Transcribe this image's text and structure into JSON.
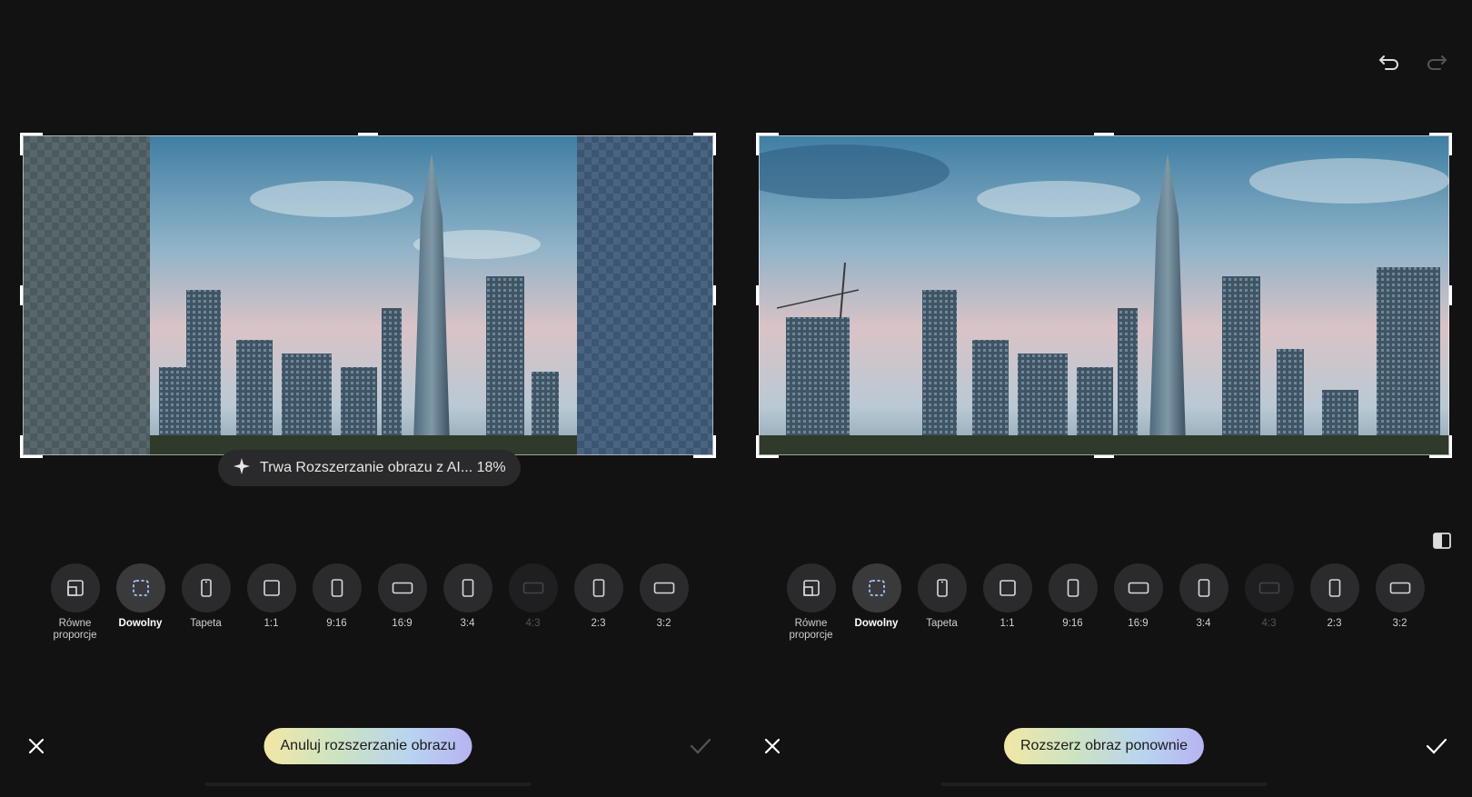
{
  "toolbar": {
    "undo_icon": "undo-icon",
    "redo_icon": "redo-icon"
  },
  "progress": {
    "text": "Trwa Rozszerzanie obrazu z AI... 18%",
    "percent": 18
  },
  "ratios": [
    {
      "label": "Równe proporcje",
      "icon": "free-aspect-icon"
    },
    {
      "label": "Dowolny",
      "icon": "dashed-square-icon",
      "active": true
    },
    {
      "label": "Tapeta",
      "icon": "phone-icon"
    },
    {
      "label": "1:1",
      "icon": "square-icon"
    },
    {
      "label": "9:16",
      "icon": "portrait-icon"
    },
    {
      "label": "16:9",
      "icon": "landscape-icon"
    },
    {
      "label": "3:4",
      "icon": "portrait-icon"
    },
    {
      "label": "4:3",
      "icon": "landscape-icon",
      "disabled": true
    },
    {
      "label": "2:3",
      "icon": "portrait-icon"
    },
    {
      "label": "3:2",
      "icon": "landscape-icon"
    }
  ],
  "left": {
    "action_label": "Anuluj rozszerzanie obrazu"
  },
  "right": {
    "action_label": "Rozszerz obraz ponownie"
  },
  "colors": {
    "accent_gradient": [
      "#f2e7a6",
      "#b7b3f2"
    ],
    "background": "#121212"
  }
}
